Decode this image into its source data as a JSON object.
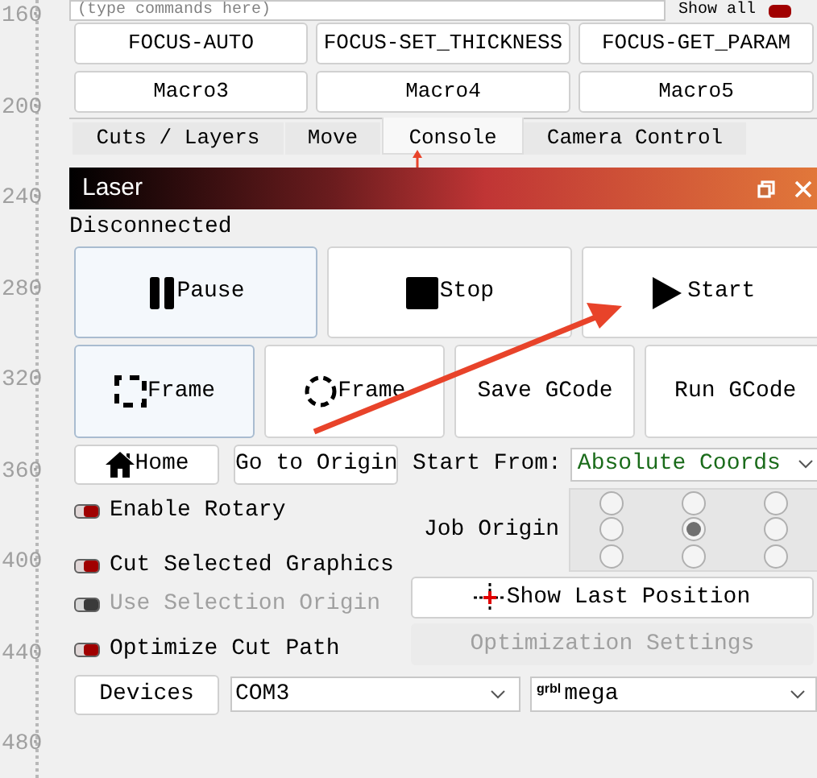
{
  "ruler": {
    "labels": [
      "160",
      "200",
      "240",
      "280",
      "320",
      "360",
      "400",
      "440",
      "480"
    ]
  },
  "console": {
    "placeholder": "(type commands here)",
    "show_all": {
      "label": "Show all",
      "checked": true
    }
  },
  "macros": [
    {
      "label": "FOCUS-AUTO"
    },
    {
      "label": "FOCUS-SET_THICKNESS"
    },
    {
      "label": "FOCUS-GET_PARAM"
    },
    {
      "label": "Macro3"
    },
    {
      "label": "Macro4"
    },
    {
      "label": "Macro5"
    }
  ],
  "tabs": [
    {
      "label": "Cuts / Layers",
      "selected": false
    },
    {
      "label": "Move",
      "selected": false
    },
    {
      "label": "Console",
      "selected": true
    },
    {
      "label": "Camera Control",
      "selected": false
    }
  ],
  "laser": {
    "title": "Laser",
    "status": "Disconnected",
    "main_buttons": [
      {
        "label": "Pause",
        "highlighted": true
      },
      {
        "label": "Stop",
        "highlighted": false
      },
      {
        "label": "Start",
        "highlighted": false
      }
    ],
    "frame_buttons": [
      {
        "label": "Frame",
        "highlighted": true
      },
      {
        "label": "Frame",
        "highlighted": false
      },
      {
        "label": "Save GCode",
        "highlighted": false
      },
      {
        "label": "Run GCode",
        "highlighted": false
      }
    ],
    "home_button": "Home",
    "go_to_origin_button": "Go to Origin",
    "start_from": {
      "label": "Start From:",
      "value": "Absolute Coords"
    },
    "options": [
      {
        "label": "Enable Rotary",
        "checked": true,
        "disabled": false
      },
      {
        "label": "Cut Selected Graphics",
        "checked": true,
        "disabled": false
      },
      {
        "label": "Use Selection Origin",
        "checked": true,
        "disabled": true
      },
      {
        "label": "Optimize Cut Path",
        "checked": true,
        "disabled": false
      }
    ],
    "job_origin": {
      "label": "Job Origin",
      "points": [
        {
          "selected": false
        },
        {
          "selected": false
        },
        {
          "selected": false
        },
        {
          "selected": false
        },
        {
          "selected": true
        },
        {
          "selected": false
        },
        {
          "selected": false
        },
        {
          "selected": false
        },
        {
          "selected": false
        }
      ]
    },
    "show_last_position_button": {
      "label": "Show Last Position",
      "disabled": false
    },
    "optimization_settings_button": {
      "label": "Optimization Settings",
      "disabled": true
    },
    "devices_button": "Devices",
    "port": {
      "value": "COM3"
    },
    "device": {
      "logo_text": "grbl",
      "value": "mega"
    }
  }
}
